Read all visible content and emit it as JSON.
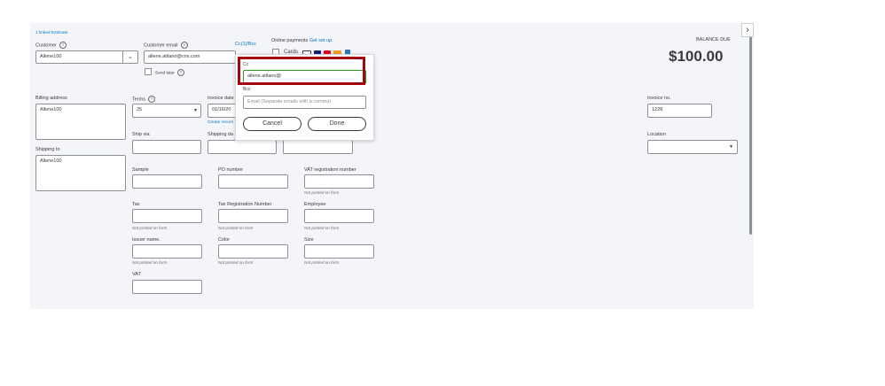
{
  "header": {
    "linked_estimate": "1 linked Estimate",
    "customer_label": "Customer",
    "customer_value": "Allene100",
    "customer_email_label": "Customer email",
    "customer_email_value": "allene.atilano@cnx.com",
    "cc_bcc_link": "Cc(1)/Bcc",
    "send_later_label": "Send later",
    "online_payments_label": "Online payments",
    "get_set_up_link": "Get set up",
    "cards_label": "Cards",
    "balance_due_label": "BALANCE DUE",
    "balance_due_value": "$100.00"
  },
  "popup": {
    "cc_label": "Cc",
    "cc_value": "allene.atilano@",
    "bcc_label": "Bcc",
    "bcc_placeholder": "Email (Separate emails with a comma)",
    "cancel_label": "Cancel",
    "done_label": "Done"
  },
  "billing": {
    "billing_address_label": "Billing address",
    "billing_address_value": "Allene100",
    "terms_label": "Terms",
    "terms_value": "25",
    "invoice_date_label": "Invoice date",
    "invoice_date_value": "01/16/20",
    "create_recurring_link": "Create recurri",
    "invoice_no_label": "Invoice no.",
    "invoice_no_value": "1228",
    "ship_via_label": "Ship via",
    "shipping_date_label": "Shipping da",
    "location_label": "Location",
    "shipping_to_label": "Shipping to",
    "shipping_to_value": "Allene100"
  },
  "custom_fields": {
    "sample_label": "Sample",
    "po_number_label": "PO number",
    "vat_reg_label": "VAT registration number",
    "tax_label": "Tax",
    "tax_reg_label": "Tax Registration Number",
    "employee_label": "Employee",
    "issuer_label": "Issuer name.",
    "color_label": "Color",
    "size_label": "Size",
    "vat_label": "VAT",
    "not_printed": "Not printed on form"
  },
  "colors": {
    "panel_bg": "#f4f5f8",
    "link_blue": "#0077c5",
    "highlight_red": "#a4040d",
    "input_focus_green": "#2ca01c"
  }
}
